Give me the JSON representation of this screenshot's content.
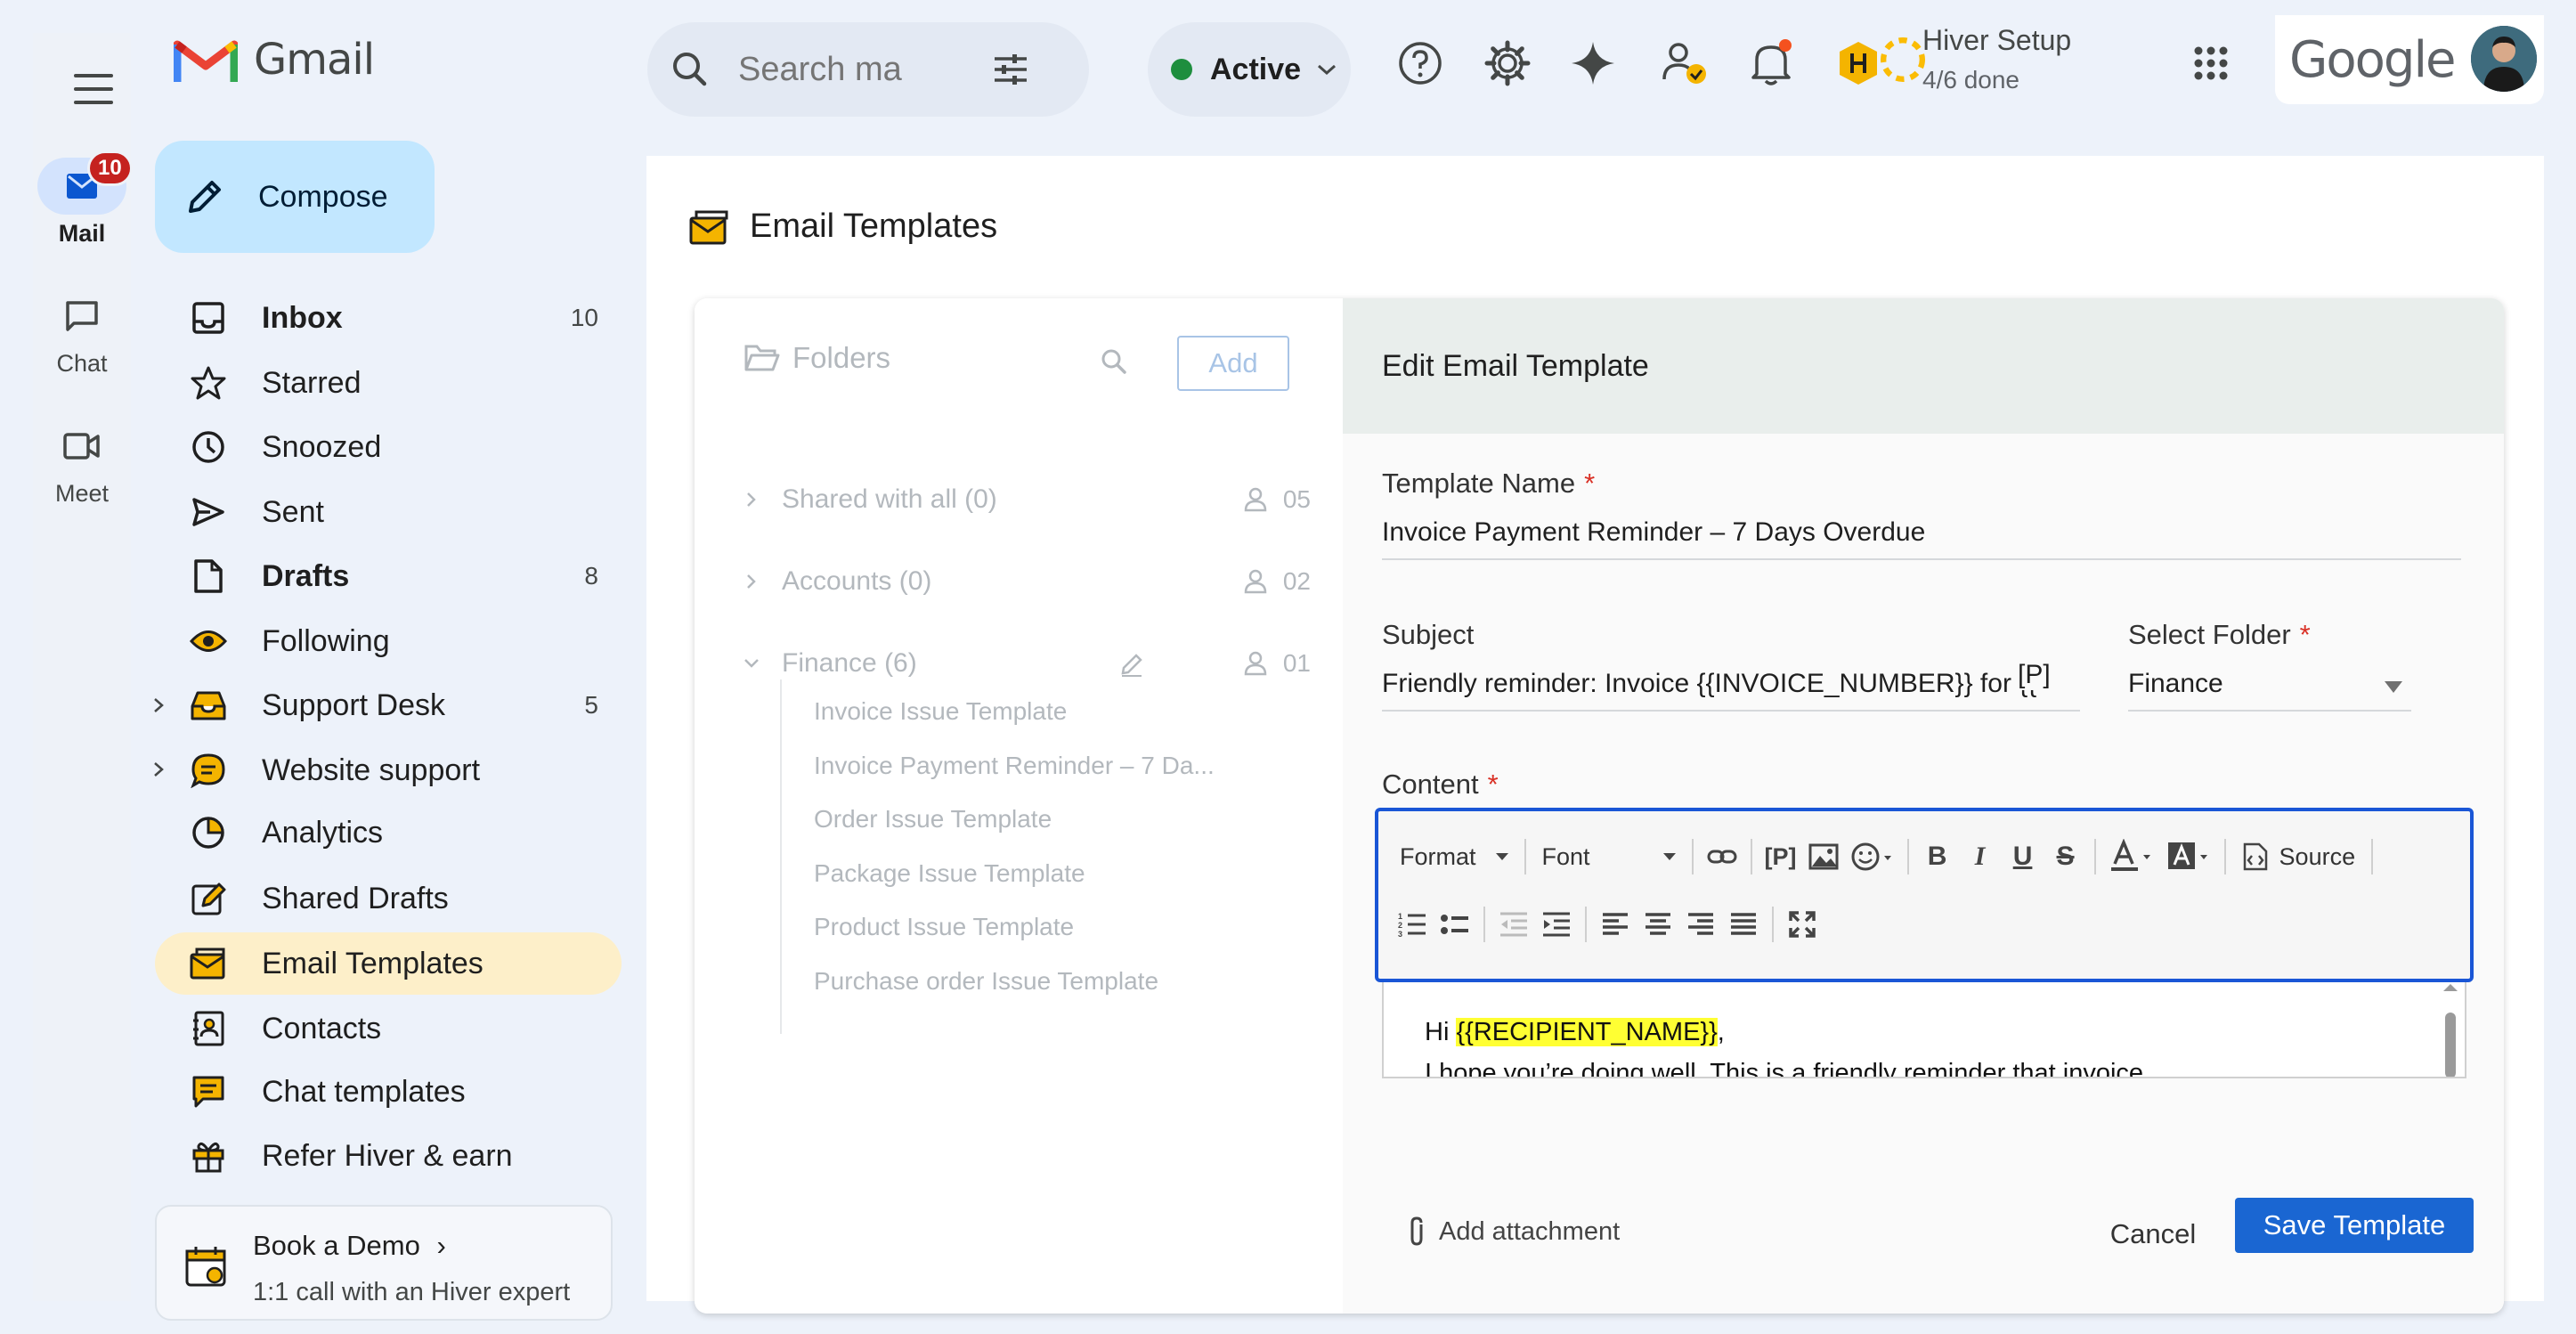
{
  "rail": {
    "items": [
      {
        "label": "Mail",
        "badge": "10"
      },
      {
        "label": "Chat"
      },
      {
        "label": "Meet"
      }
    ]
  },
  "topbar": {
    "app_name": "Gmail",
    "search_placeholder": "Search ma",
    "status_label": "Active",
    "hiver_setup_title": "Hiver Setup",
    "hiver_setup_progress": "4/6 done",
    "google_label": "Google"
  },
  "nav": {
    "compose_label": "Compose",
    "items": [
      {
        "label": "Inbox",
        "count": "10"
      },
      {
        "label": "Starred"
      },
      {
        "label": "Snoozed"
      },
      {
        "label": "Sent"
      },
      {
        "label": "Drafts",
        "count": "8"
      },
      {
        "label": "Following"
      },
      {
        "label": "Support Desk",
        "count": "5"
      },
      {
        "label": "Website support"
      },
      {
        "label": "Analytics"
      },
      {
        "label": "Shared Drafts"
      },
      {
        "label": "Email Templates"
      },
      {
        "label": "Contacts"
      },
      {
        "label": "Chat templates"
      },
      {
        "label": "Refer Hiver & earn"
      }
    ],
    "demo": {
      "title": "Book a Demo",
      "subtitle": "1:1 call with an Hiver expert"
    }
  },
  "page": {
    "title": "Email Templates"
  },
  "folders": {
    "header": "Folders",
    "add_label": "Add",
    "rows": [
      {
        "label": "Shared with all (0)",
        "count": "05"
      },
      {
        "label": "Accounts (0)",
        "count": "02"
      },
      {
        "label": "Finance (6)",
        "count": "01"
      }
    ],
    "templates": [
      "Invoice Issue Template",
      "Invoice Payment Reminder – 7 Da...",
      "Order Issue Template",
      "Package Issue Template",
      "Product Issue Template",
      "Purchase order Issue Template"
    ]
  },
  "editor": {
    "header": "Edit Email Template",
    "name_label": "Template Name",
    "name_value": "Invoice Payment Reminder – 7 Days Overdue",
    "subject_label": "Subject",
    "subject_value": "Friendly reminder: Invoice {{INVOICE_NUMBER}} for {{",
    "subject_placeholder_btn": "[P]",
    "folder_label": "Select Folder",
    "folder_value": "Finance",
    "content_label": "Content",
    "toolbar": {
      "format_label": "Format",
      "font_label": "Font",
      "source_label": "Source"
    },
    "body": {
      "greeting_prefix": "Hi ",
      "greeting_var": "{{RECIPIENT_NAME}}",
      "greeting_suffix": ",",
      "line2": "I hope you’re doing well. This is a friendly reminder that invoice"
    },
    "attach_label": "Add attachment",
    "cancel_label": "Cancel",
    "save_label": "Save Template"
  },
  "colors": {
    "accent_blue": "#1a66d2",
    "active_nav": "#fdefc9",
    "compose_bg": "#c2e7ff",
    "highlight": "#ffff33"
  }
}
